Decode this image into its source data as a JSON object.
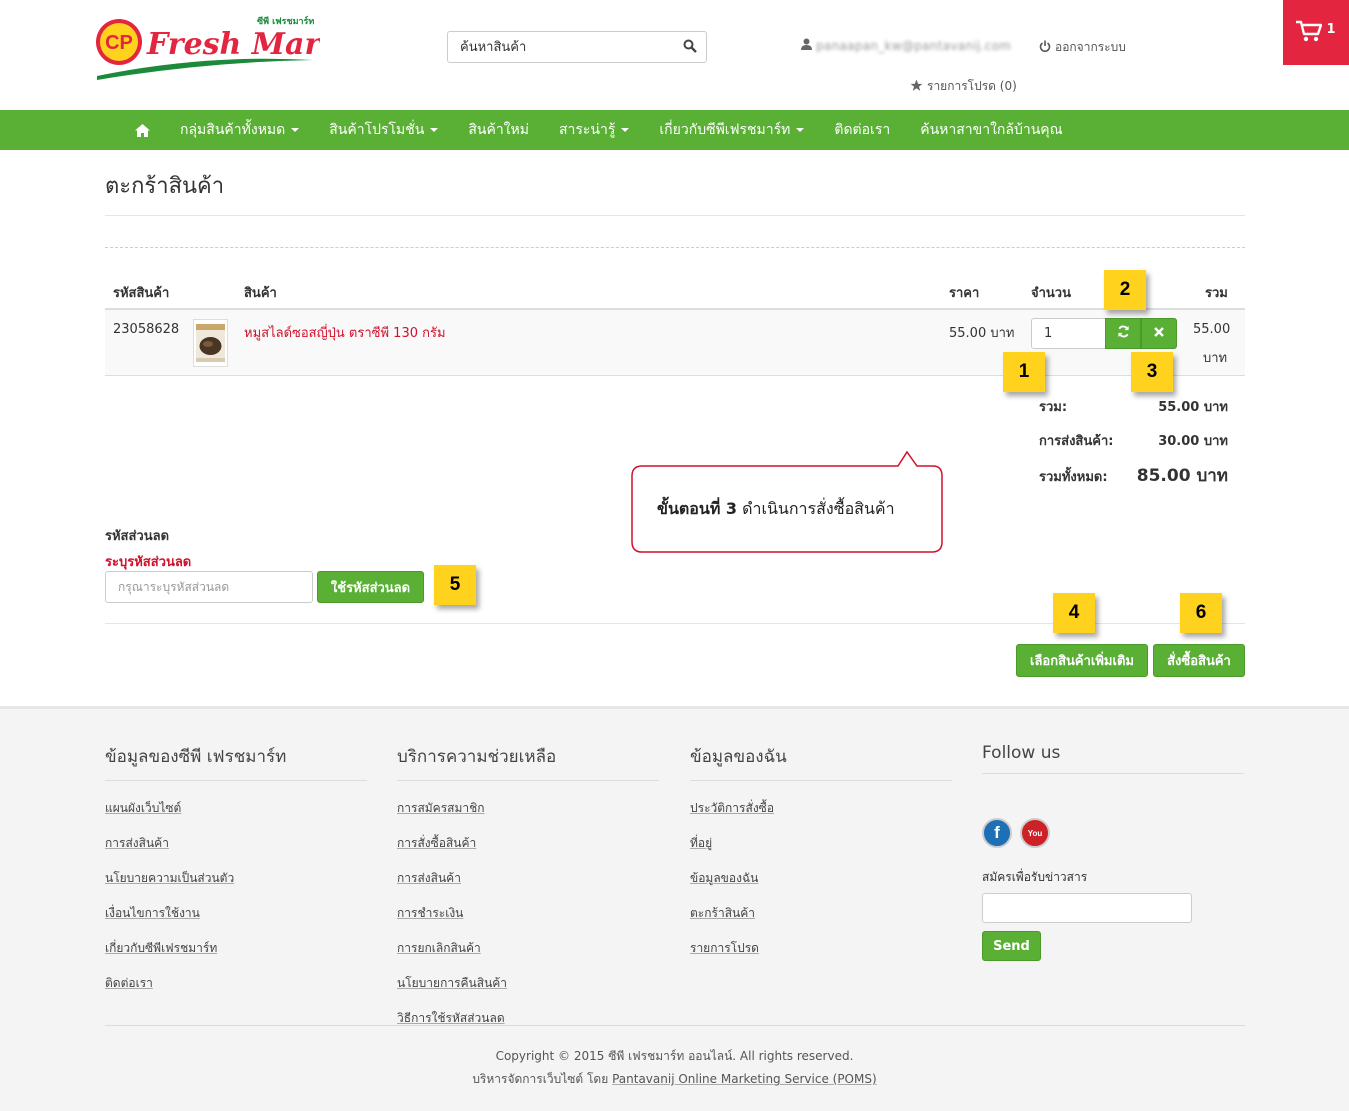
{
  "header": {
    "logo_text": "Fresh Mart",
    "logo_cp": "CP",
    "logo_sub": "ซีพี เฟรชมาร์ท",
    "search_placeholder": "ค้นหาสินค้า",
    "user_email": "panaapan_kw@pantavanij.com",
    "logout_label": "ออกจากระบบ",
    "wishlist_label": "รายการโปรด (0)",
    "cart_count": "1",
    "brand_red": "#e4253f",
    "brand_green": "#5ab035"
  },
  "nav": {
    "items": [
      {
        "label": "กลุ่มสินค้าทั้งหมด",
        "dropdown": true
      },
      {
        "label": "สินค้าโปรโมชั่น",
        "dropdown": true
      },
      {
        "label": "สินค้าใหม่",
        "dropdown": false
      },
      {
        "label": "สาระน่ารู้",
        "dropdown": true
      },
      {
        "label": "เกี่ยวกับซีพีเฟรชมาร์ท",
        "dropdown": true
      },
      {
        "label": "ติดต่อเรา",
        "dropdown": false
      },
      {
        "label": "ค้นหาสาขาใกล้บ้านคุณ",
        "dropdown": false
      }
    ]
  },
  "cart": {
    "title": "ตะกร้าสินค้า",
    "columns": {
      "code": "รหัสสินค้า",
      "product": "สินค้า",
      "price": "ราคา",
      "qty": "จำนวน",
      "total": "รวม"
    },
    "rows": [
      {
        "code": "23058628",
        "name": "หมูสไลด์ซอสญี่ปุ่น ตราซีพี 130 กรัม",
        "price": "55.00 บาท",
        "qty": "1",
        "total_amount": "55.00",
        "total_unit": "บาท"
      }
    ],
    "summary": {
      "subtotal_label": "รวม:",
      "subtotal_value": "55.00 บาท",
      "shipping_label": "การส่งสินค้า:",
      "shipping_value": "30.00 บาท",
      "grand_label": "รวมทั้งหมด:",
      "grand_value": "85.00 บาท"
    },
    "coupon": {
      "title": "รหัสส่วนลด",
      "required_label": "ระบุรหัสส่วนลด",
      "placeholder": "กรุณาระบุรหัสส่วนลด",
      "apply_label": "ใช้รหัสส่วนลด"
    },
    "continue_label": "เลือกสินค้าเพิ่มเติม",
    "checkout_label": "สั่งซื้อสินค้า"
  },
  "annotations": {
    "badges": [
      "1",
      "2",
      "3",
      "4",
      "5",
      "6"
    ],
    "callout_bold": "ขั้นตอนที่ 3",
    "callout_text": " ดำเนินการสั่งซื้อสินค้า",
    "badge_color": "#ffd21e"
  },
  "footer": {
    "col1": {
      "title": "ข้อมูลของซีพี เฟรชมาร์ท",
      "links": [
        "แผนผังเว็บไซต์",
        "การส่งสินค้า",
        "นโยบายความเป็นส่วนตัว",
        "เงื่อนไขการใช้งาน",
        "เกี่ยวกับซีพีเฟรชมาร์ท",
        "ติดต่อเรา"
      ]
    },
    "col2": {
      "title": "บริการความช่วยเหลือ",
      "links": [
        "การสมัครสมาชิก",
        "การสั่งซื้อสินค้า",
        "การส่งสินค้า",
        "การชำระเงิน",
        "การยกเลิกสินค้า",
        "นโยบายการคืนสินค้า",
        "วิธีการใช้รหัสส่วนลด"
      ]
    },
    "col3": {
      "title": "ข้อมูลของฉัน",
      "links": [
        "ประวัติการสั่งซื้อ",
        "ที่อยู่",
        "ข้อมูลของฉัน",
        "ตะกร้าสินค้า",
        "รายการโปรด"
      ]
    },
    "col4": {
      "title": "Follow us",
      "facebook": "f",
      "youtube": "You",
      "newsletter_label": "สมัครเพื่อรับข่าวสาร",
      "send_label": "Send"
    },
    "copyright": "Copyright © 2015 ซีพี เฟรชมาร์ท ออนไลน์. All rights reserved.",
    "managed_prefix": "บริหารจัดการเว็บไซต์ โดย ",
    "managed_link": "Pantavanij Online Marketing Service (POMS)"
  }
}
